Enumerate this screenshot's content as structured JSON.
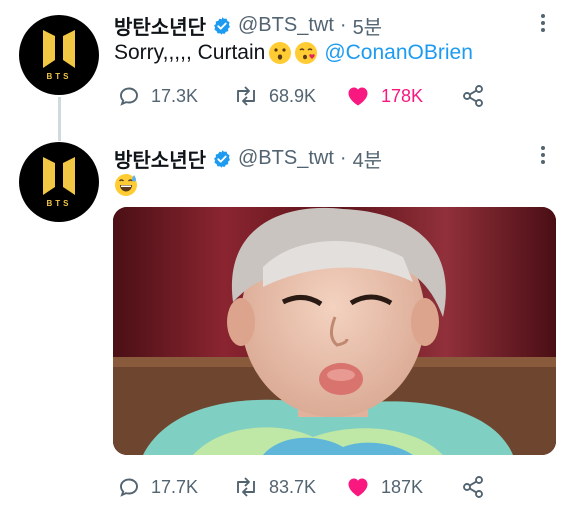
{
  "tweets": [
    {
      "name": "방탄소년단",
      "handle": "@BTS_twt",
      "time": "5분",
      "text": "Sorry,,,,, Curtain",
      "emoji_1": "kissing-face-icon",
      "emoji_2": "face-blowing-kiss-icon",
      "mention": "@ConanOBrien",
      "replies": "17.3K",
      "retweets": "68.9K",
      "likes": "178K",
      "liked": true
    },
    {
      "name": "방탄소년단",
      "handle": "@BTS_twt",
      "time": "4분",
      "emoji": "grinning-face-with-sweat-icon",
      "media": "selfie-photo",
      "replies": "17.7K",
      "retweets": "83.7K",
      "likes": "187K",
      "liked": true
    }
  ],
  "avatar_text": "BTS",
  "colors": {
    "link": "#1d9bf0",
    "like": "#f91880",
    "muted": "#536471",
    "avatar_logo": "#f2c744",
    "verified": "#1d9bf0"
  }
}
